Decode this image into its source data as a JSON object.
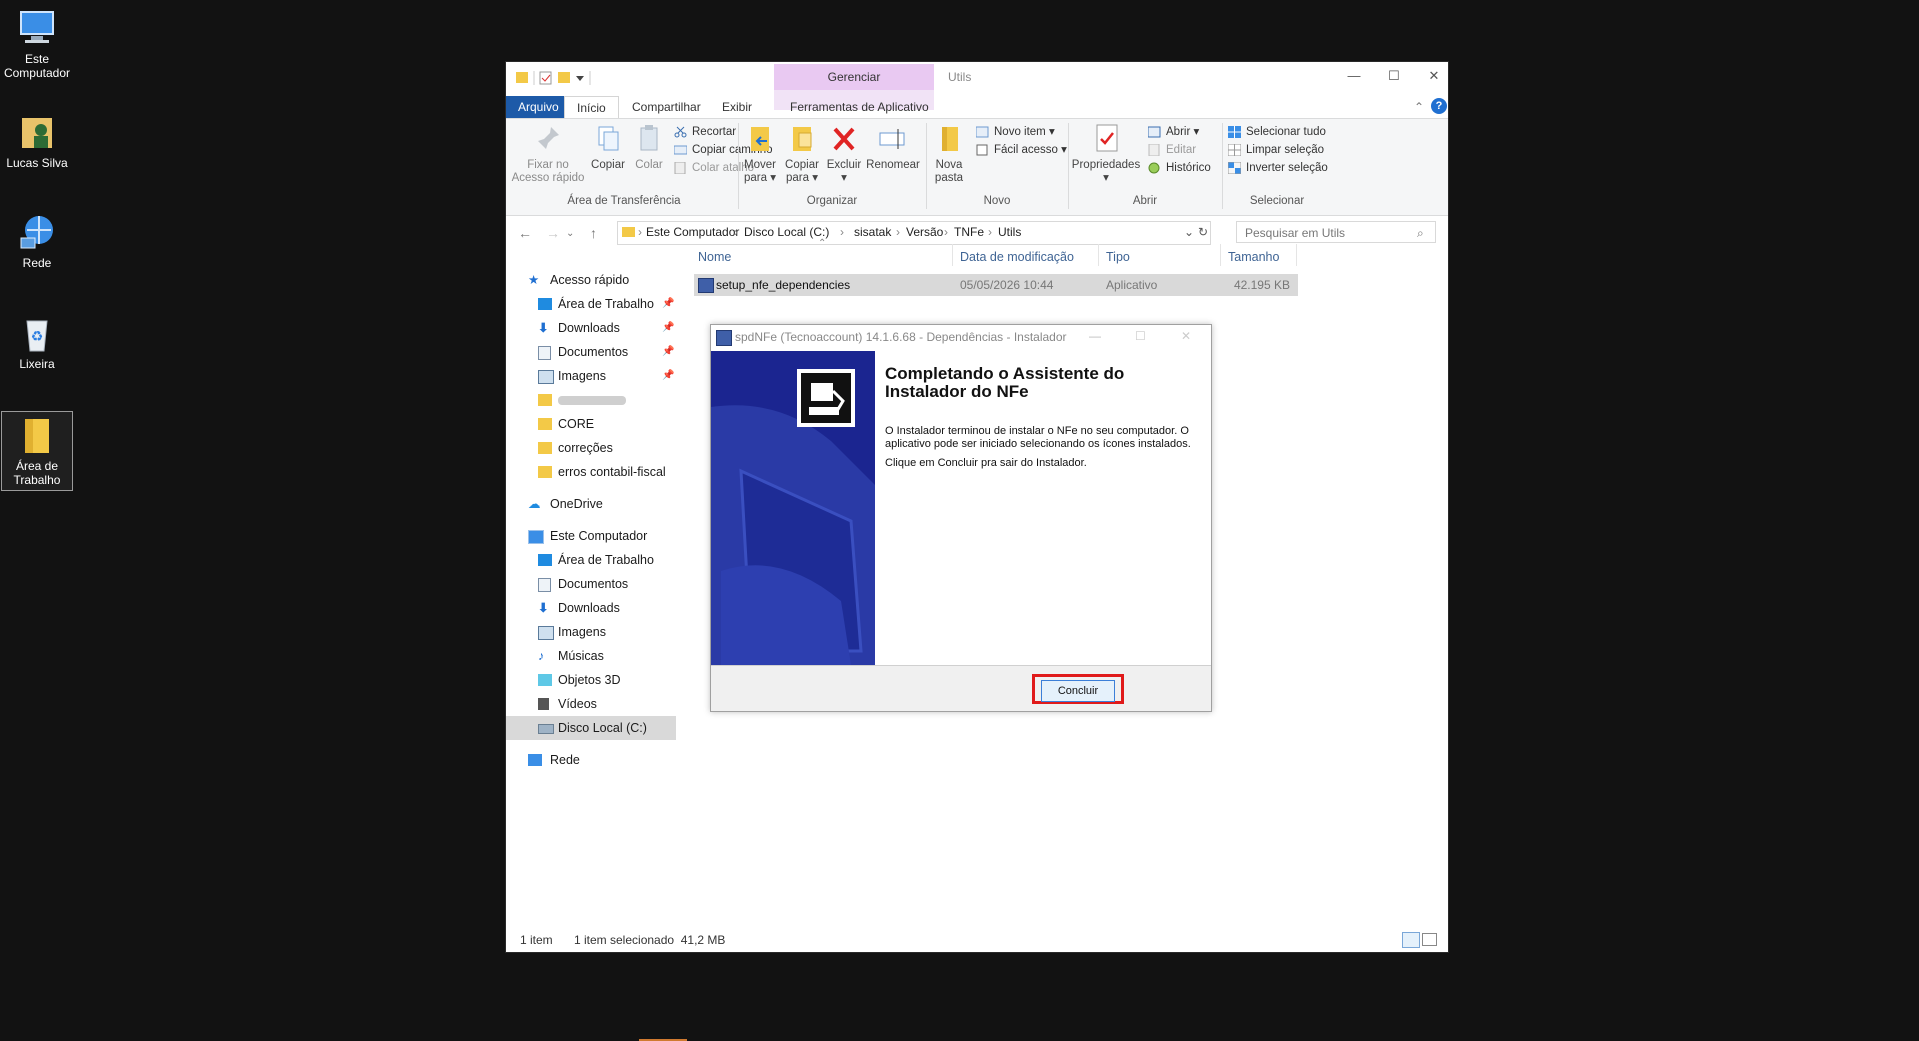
{
  "desktop": {
    "icons": [
      {
        "label_line1": "Este",
        "label_line2": "Computador",
        "icon": "computer-icon"
      },
      {
        "label_line1": "Lucas Silva",
        "label_line2": "",
        "icon": "user-folder-icon"
      },
      {
        "label_line1": "Rede",
        "label_line2": "",
        "icon": "network-icon"
      },
      {
        "label_line1": "Lixeira",
        "label_line2": "",
        "icon": "recycle-bin-icon"
      },
      {
        "label_line1": "Área de",
        "label_line2": "Trabalho",
        "icon": "folder-icon"
      }
    ]
  },
  "explorer": {
    "title": "Utils",
    "context_tab": "Gerenciar",
    "context_subtab": "Ferramentas de Aplicativo",
    "tabs": [
      "Arquivo",
      "Início",
      "Compartilhar",
      "Exibir"
    ],
    "ribbon": {
      "clipboard": {
        "pin_line1": "Fixar no",
        "pin_line2": "Acesso rápido",
        "copy": "Copiar",
        "paste": "Colar",
        "cut": "Recortar",
        "copy_path": "Copiar caminho",
        "paste_shortcut": "Colar atalho",
        "group": "Área de Transferência"
      },
      "organize": {
        "move_line1": "Mover",
        "move_line2": "para",
        "copyto_line1": "Copiar",
        "copyto_line2": "para",
        "delete": "Excluir",
        "rename": "Renomear",
        "group": "Organizar"
      },
      "new": {
        "folder_line1": "Nova",
        "folder_line2": "pasta",
        "new_item": "Novo item",
        "easy_access": "Fácil acesso",
        "group": "Novo"
      },
      "open": {
        "properties": "Propriedades",
        "open": "Abrir",
        "edit": "Editar",
        "history": "Histórico",
        "group": "Abrir"
      },
      "select": {
        "select_all": "Selecionar tudo",
        "select_none": "Limpar seleção",
        "invert": "Inverter seleção",
        "group": "Selecionar"
      }
    },
    "breadcrumb": [
      "Este Computador",
      "Disco Local (C:)",
      "sisatak",
      "Versão",
      "TNFe",
      "Utils"
    ],
    "search_placeholder": "Pesquisar em Utils",
    "nav": {
      "quick_access": "Acesso rápido",
      "qa_items": [
        "Área de Trabalho",
        "Downloads",
        "Documentos",
        "Imagens",
        "",
        "CORE",
        "correções",
        "erros contabil-fiscal"
      ],
      "onedrive": "OneDrive",
      "this_pc": "Este Computador",
      "pc_items": [
        "Área de Trabalho",
        "Documentos",
        "Downloads",
        "Imagens",
        "Músicas",
        "Objetos 3D",
        "Vídeos",
        "Disco Local (C:)"
      ],
      "network": "Rede"
    },
    "columns": {
      "name": "Nome",
      "modified": "Data de modificação",
      "type": "Tipo",
      "size": "Tamanho"
    },
    "files": [
      {
        "name": "setup_nfe_dependencies",
        "modified": "05/05/2026 10:44",
        "type": "Aplicativo",
        "size": "42.195 KB"
      }
    ],
    "status": {
      "count": "1 item",
      "selected": "1 item selecionado  41,2 MB"
    }
  },
  "installer": {
    "title": "spdNFe (Tecnoaccount) 14.1.6.68 - Dependências - Instalador",
    "heading": "Completando o Assistente do Instalador do NFe",
    "paragraph1": "O Instalador terminou de instalar o NFe no seu computador. O aplicativo pode ser iniciado selecionando os ícones instalados.",
    "paragraph2": "Clique em Concluir pra sair do Instalador.",
    "finish_button": "Concluir"
  },
  "colors": {
    "accent": "#1d5aa8",
    "context_tab": "#e9c9f2",
    "highlight": "#e01a1a",
    "installer_side": "#1a2a8c"
  }
}
